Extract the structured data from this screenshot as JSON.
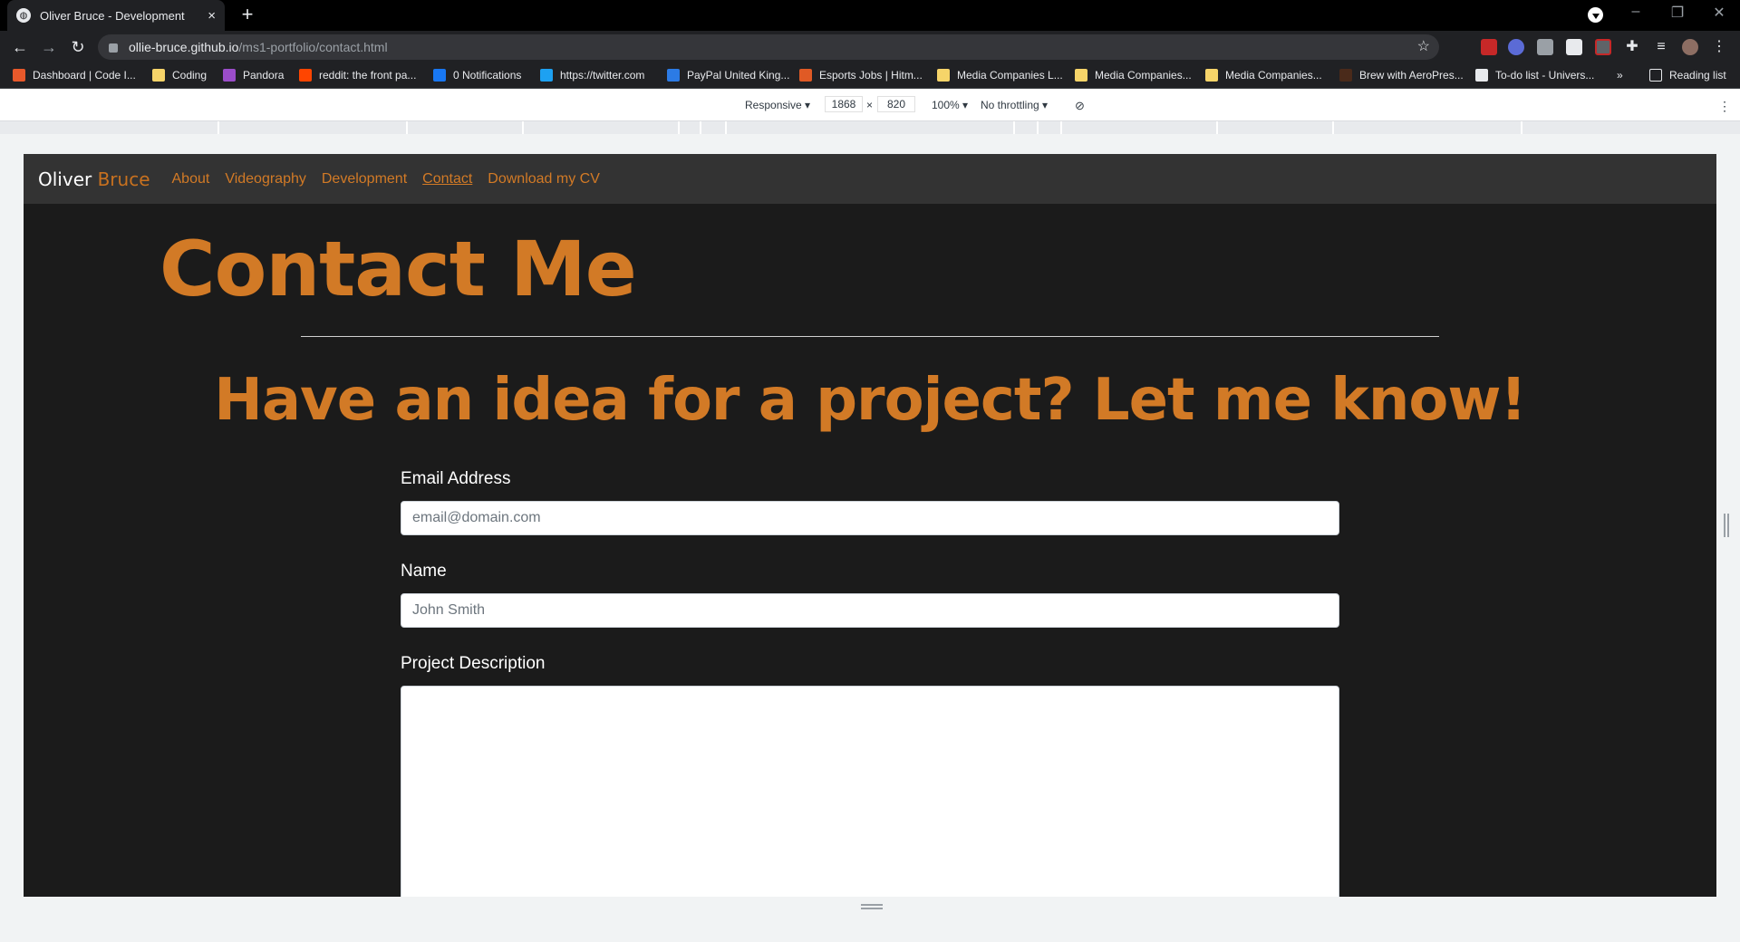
{
  "browser": {
    "tab_title": "Oliver Bruce - Development",
    "tab_close": "×",
    "new_tab": "+",
    "url_host": "ollie-bruce.github.io",
    "url_path": "/ms1-portfolio/contact.html",
    "bookmarks": [
      {
        "label": "Dashboard | Code I...",
        "color": "#e8592b"
      },
      {
        "label": "Coding",
        "color": "#f6d469"
      },
      {
        "label": "Pandora",
        "color": "#9b4dca"
      },
      {
        "label": "reddit: the front pa...",
        "color": "#ff4500"
      },
      {
        "label": "0 Notifications",
        "color": "#1877f2"
      },
      {
        "label": "https://twitter.com",
        "color": "#1da1f2"
      },
      {
        "label": "PayPal United King...",
        "color": "#2c7be5"
      },
      {
        "label": "Esports Jobs | Hitm...",
        "color": "#e05a25"
      },
      {
        "label": "Media Companies L...",
        "color": "#f6d469"
      },
      {
        "label": "Media Companies...",
        "color": "#f6d469"
      },
      {
        "label": "Media Companies...",
        "color": "#f6d469"
      },
      {
        "label": "Brew with AeroPres...",
        "color": "#4a2a1a"
      },
      {
        "label": "To-do list - Univers...",
        "color": "#e8eaed"
      }
    ],
    "bookmarks_more": "»",
    "reading_list": "Reading list"
  },
  "devtools": {
    "device": "Responsive ▾",
    "width": "1868",
    "times": "×",
    "height": "820",
    "zoom": "100% ▾",
    "throttling": "No throttling ▾"
  },
  "site": {
    "brand_first": "Oliver",
    "brand_last": "Bruce",
    "nav": [
      "About",
      "Videography",
      "Development",
      "Contact",
      "Download my CV"
    ],
    "heading": "Contact Me",
    "tagline": "Have an idea for a project? Let me know!",
    "form": {
      "email_label": "Email Address",
      "email_placeholder": "email@domain.com",
      "name_label": "Name",
      "name_placeholder": "John Smith",
      "description_label": "Project Description"
    },
    "accent_color": "#d27a26",
    "background_color": "#1b1b1b"
  }
}
